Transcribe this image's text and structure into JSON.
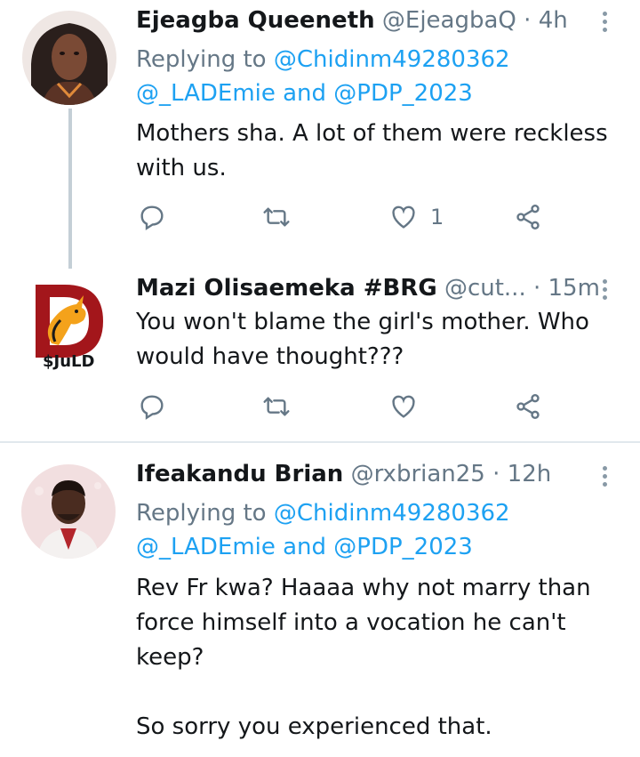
{
  "tweets": [
    {
      "name": "Ejeagba Queeneth",
      "handle": "@EjeagbaQ",
      "dot": " · ",
      "time": "4h",
      "reply_prefix": "Replying to ",
      "reply_mentions_line1": "@Chidinm49280362",
      "reply_mentions_line2": "@_LADEmie and @PDP_2023",
      "text": "Mothers sha. A lot of them were reckless\nwith us.",
      "like_count": "1",
      "icons": [
        "reply-icon",
        "retweet-icon",
        "like-icon",
        "share-icon"
      ]
    },
    {
      "name": "Mazi Olisaemeka #BRG",
      "handle": "@cut...",
      "dot": " · ",
      "time": "15m",
      "avatar_label": "$JuLD",
      "text": "You won't blame the girl's mother. Who\nwould have thought???",
      "like_count": "",
      "icons": [
        "reply-icon",
        "retweet-icon",
        "like-icon",
        "share-icon"
      ]
    },
    {
      "name": "Ifeakandu Brian",
      "handle": "@rxbrian25",
      "dot": " · ",
      "time": "12h",
      "reply_prefix": "Replying to ",
      "reply_mentions_line1": "@Chidinm49280362",
      "reply_mentions_line2": "@_LADEmie and @PDP_2023",
      "text": "Rev Fr kwa? Haaaa why not marry than\nforce himself into a vocation he can't\nkeep?\n\nSo sorry you experienced that."
    }
  ],
  "colors": {
    "link": "#1da1f2",
    "muted": "#657786",
    "divider": "#e1e8ed",
    "thread": "#c4cfd6"
  }
}
